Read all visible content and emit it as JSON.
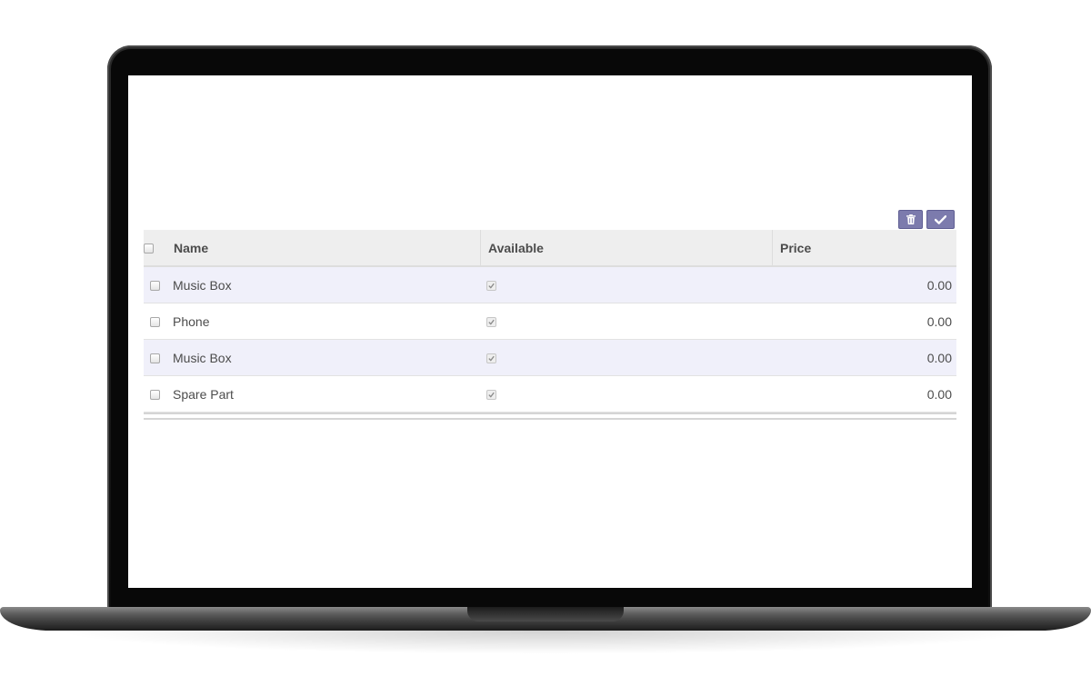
{
  "toolbar": {
    "delete_icon": "trash-icon",
    "save_icon": "checkmark-icon",
    "accent_color": "#7c7bad"
  },
  "table": {
    "columns": [
      {
        "key": "name",
        "label": "Name"
      },
      {
        "key": "available",
        "label": "Available"
      },
      {
        "key": "price",
        "label": "Price"
      }
    ],
    "rows": [
      {
        "name": "Music Box",
        "available": true,
        "price": "0.00"
      },
      {
        "name": "Phone",
        "available": true,
        "price": "0.00"
      },
      {
        "name": "Music Box",
        "available": true,
        "price": "0.00"
      },
      {
        "name": "Spare Part",
        "available": true,
        "price": "0.00"
      }
    ]
  },
  "colors": {
    "row_odd": "#f0f0fa",
    "header_bg": "#eeeeee"
  }
}
